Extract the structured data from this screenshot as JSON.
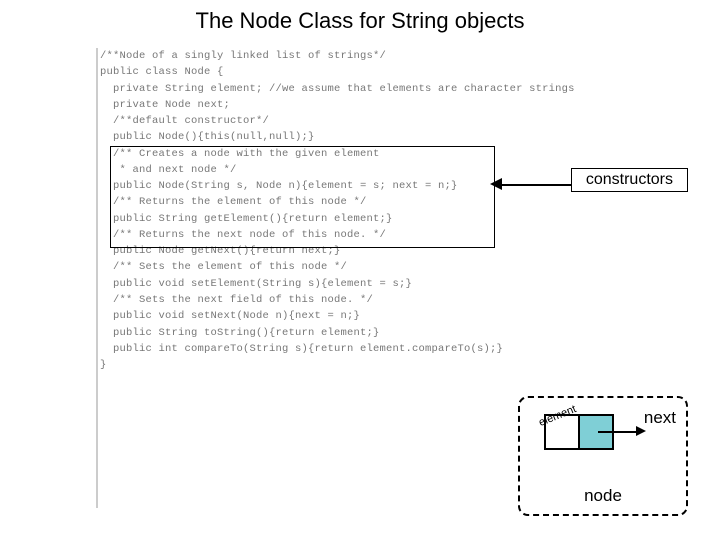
{
  "title": "The Node Class for String objects",
  "labels": {
    "constructors": "constructors",
    "element": "element",
    "next": "next",
    "node": "node"
  },
  "code": [
    "/**Node of a singly linked list of strings*/",
    "public class Node {",
    "",
    "  private String element; //we assume that elements are character strings",
    "  private Node next;",
    "",
    "  /**default constructor*/",
    "  public Node(){this(null,null);}",
    "",
    "  /** Creates a node with the given element",
    "   * and next node */",
    "  public Node(String s, Node n){element = s; next = n;}",
    "",
    "  /** Returns the element of this node */",
    "  public String getElement(){return element;}",
    "",
    "  /** Returns the next node of this node. */",
    "  public Node getNext(){return next;}",
    "",
    "  /** Sets the element of this node */",
    "  public void setElement(String s){element = s;}",
    "",
    "  /** Sets the next field of this node. */",
    "  public void setNext(Node n){next = n;}",
    "",
    "  public String toString(){return element;}",
    "",
    "  public int compareTo(String s){return element.compareTo(s);}",
    "}"
  ]
}
